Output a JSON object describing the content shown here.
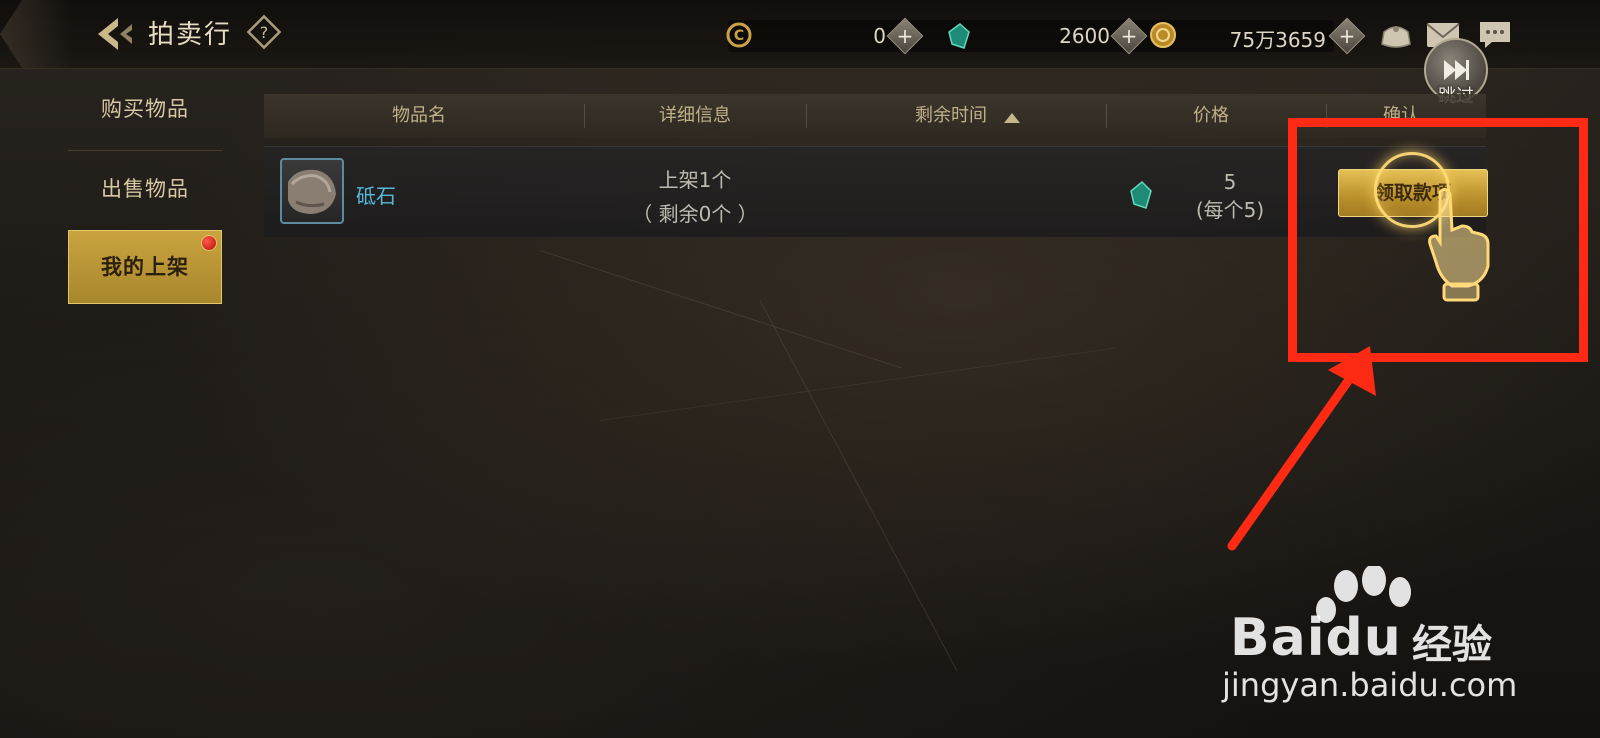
{
  "header": {
    "title": "拍卖行",
    "skip_label": "跳过"
  },
  "currencies": [
    {
      "icon": "coin-c-icon",
      "value": "0"
    },
    {
      "icon": "green-gem-icon",
      "value": "2600"
    },
    {
      "icon": "gold-coin-icon",
      "value": "75万3659"
    }
  ],
  "sidebar": {
    "items": [
      {
        "label": "购买物品"
      },
      {
        "label": "出售物品"
      },
      {
        "label": "我的上架",
        "active": true,
        "badge": "red-dot"
      }
    ]
  },
  "table": {
    "headers": [
      "物品名",
      "详细信息",
      "剩余时间",
      "价格",
      "确认"
    ],
    "rows": [
      {
        "item_name": "砥石",
        "detail_line1": "上架1个",
        "detail_line2": "（ 剩余0个 ）",
        "remaining_time": "",
        "price": "5",
        "price_each": "(每个5)",
        "action_label": "领取款项"
      }
    ]
  },
  "watermark": {
    "brand_latin": "Baidu",
    "brand_cn": "经验",
    "url": "jingyan.baidu.com"
  },
  "colors": {
    "accent_gold": "#c9a43f",
    "annotation_red": "#ff2a14",
    "item_name_blue": "#57b7d8"
  }
}
